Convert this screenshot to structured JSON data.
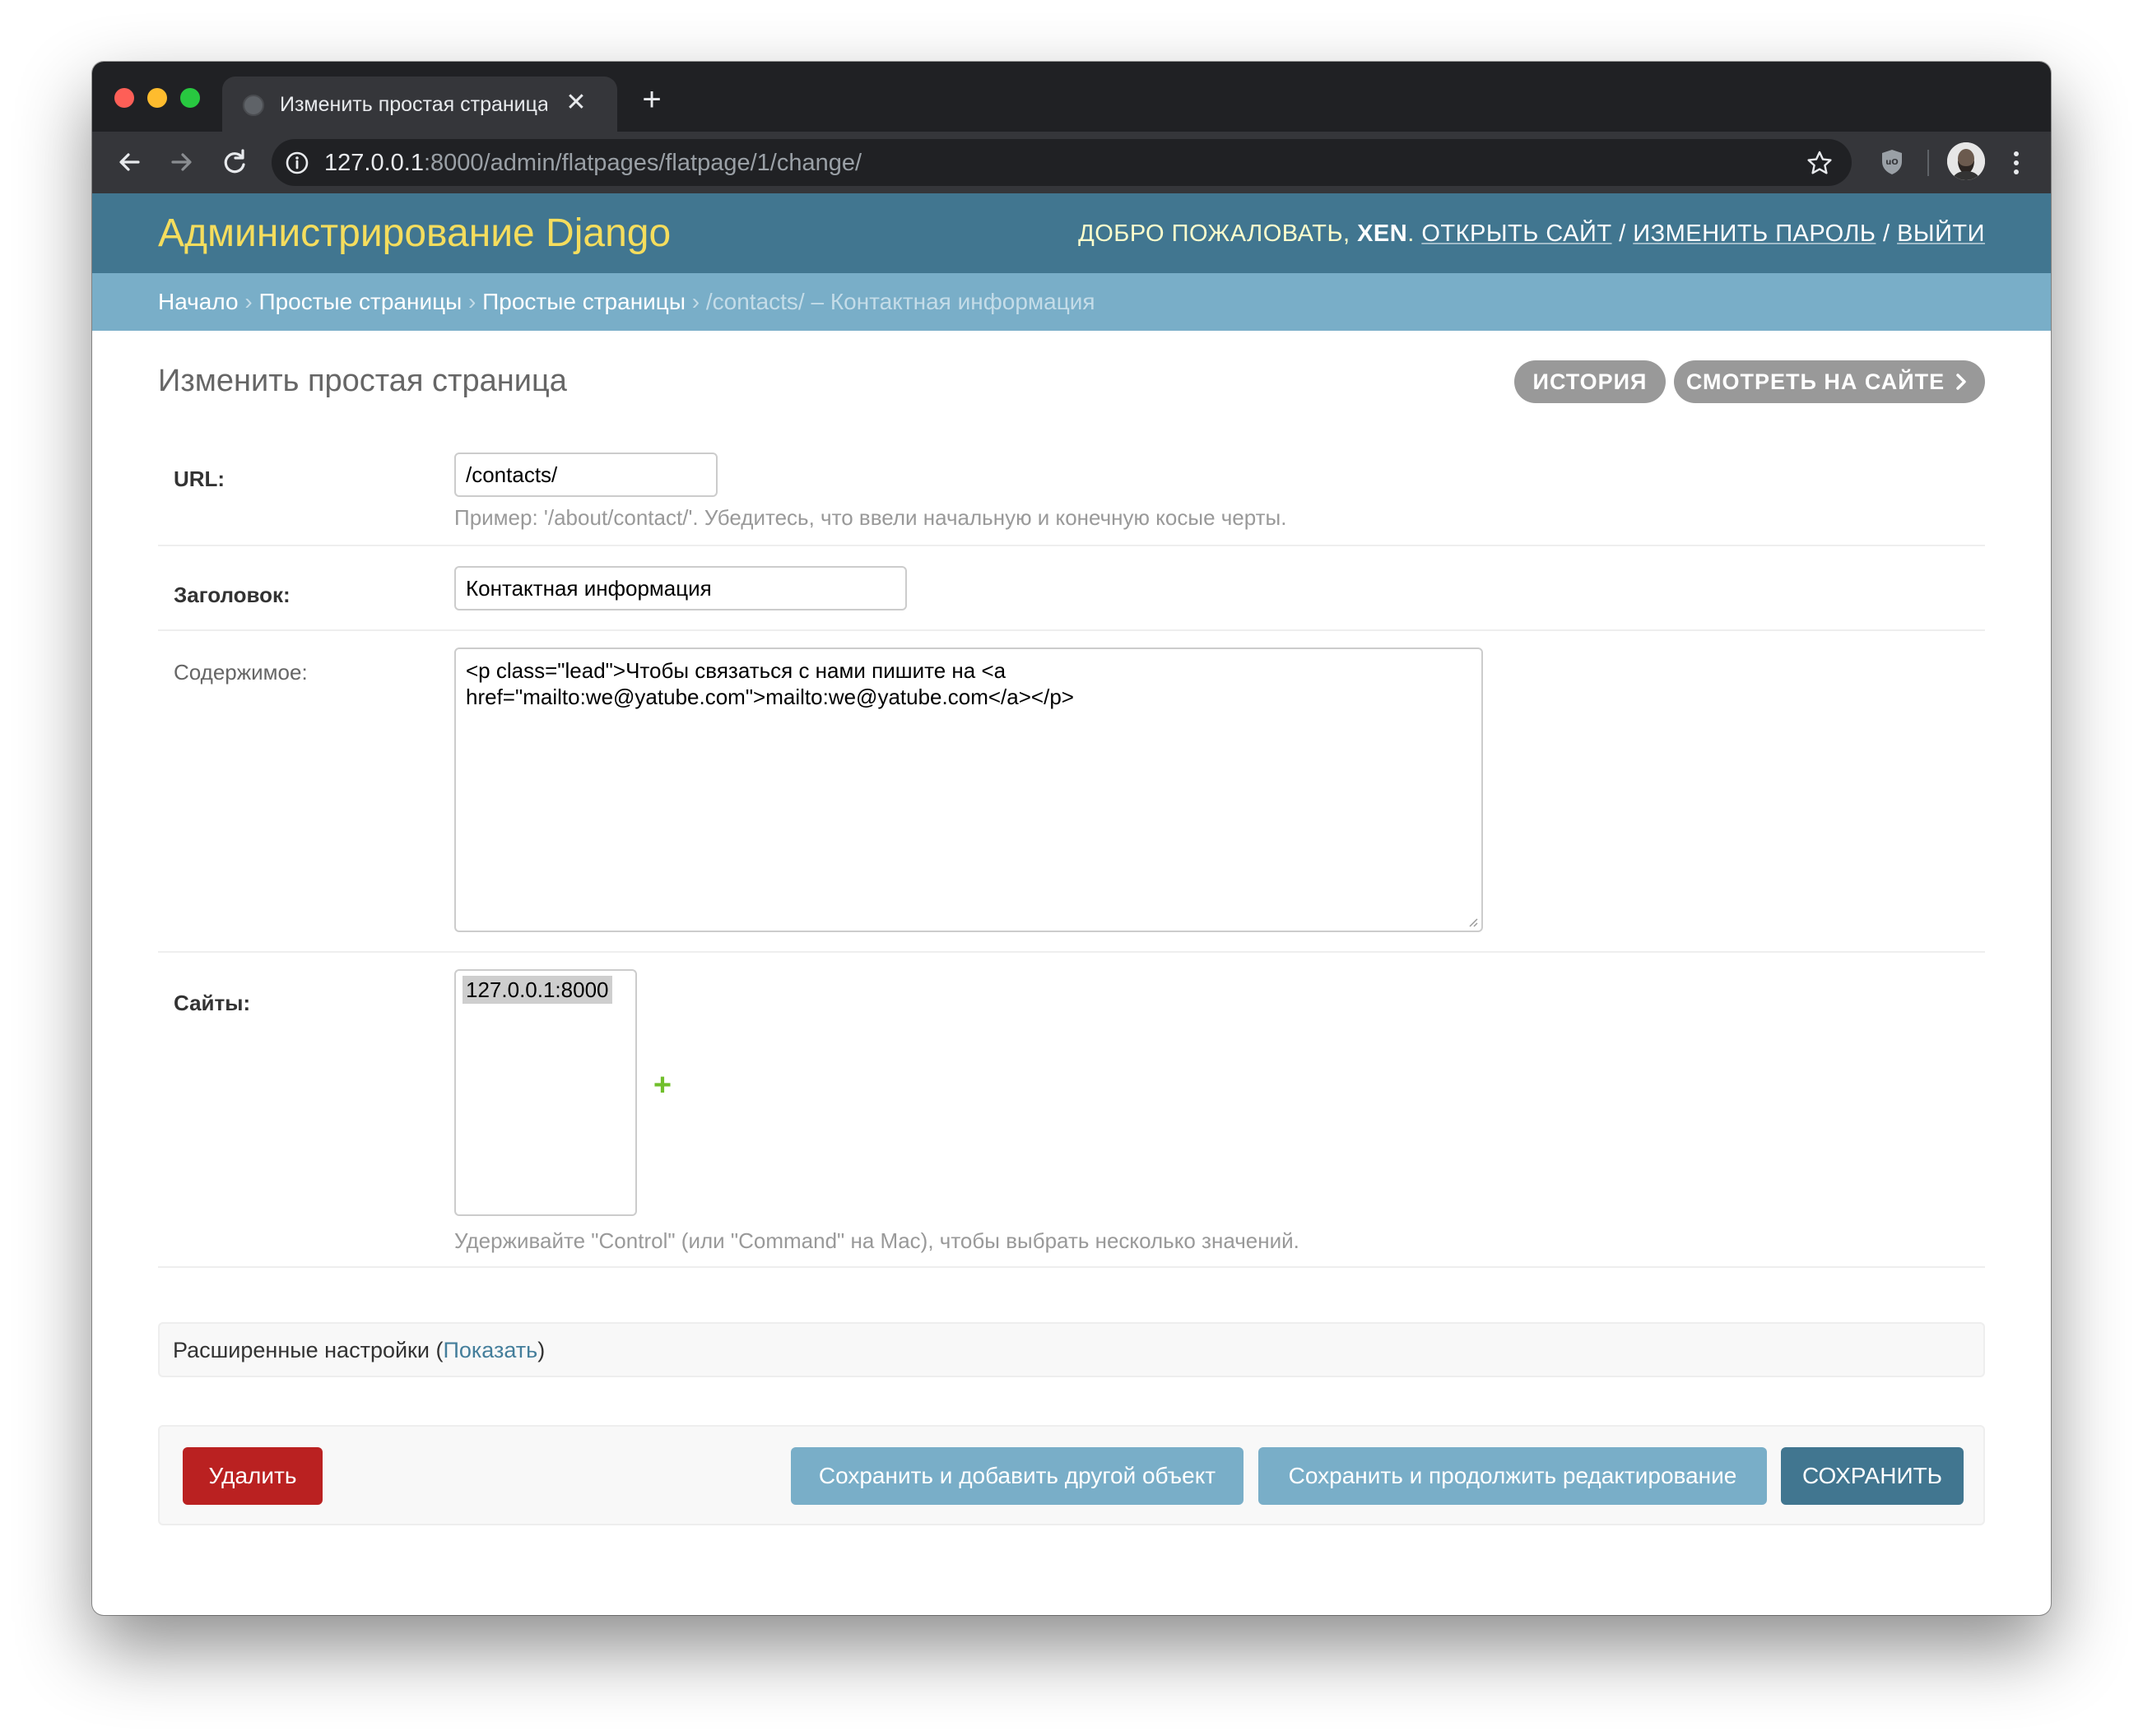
{
  "browser": {
    "tab_title": "Изменить простая страница | Администрирование Django",
    "tab_close": "✕",
    "new_tab": "+",
    "url_host": "127.0.0.1",
    "url_rest": ":8000/admin/flatpages/flatpage/1/change/"
  },
  "header": {
    "brand": "Администрирование Django",
    "welcome": "ДОБРО ПОЖАЛОВАТЬ,",
    "username": "XEN",
    "username_suffix": ".",
    "view_site": "ОТКРЫТЬ САЙТ",
    "separator": "/",
    "change_password": "ИЗМЕНИТЬ ПАРОЛЬ",
    "logout": "ВЫЙТИ"
  },
  "breadcrumbs": {
    "home": "Начало",
    "app": "Простые страницы",
    "model": "Простые страницы",
    "current": "/contacts/ – Контактная информация",
    "sep": "›"
  },
  "page": {
    "title": "Изменить простая страница",
    "history_label": "ИСТОРИЯ",
    "view_on_site_label": "СМОТРЕТЬ НА САЙТЕ"
  },
  "form": {
    "url": {
      "label": "URL:",
      "value": "/contacts/",
      "help": "Пример: '/about/contact/'. Убедитесь, что ввели начальную и конечную косые черты."
    },
    "title": {
      "label": "Заголовок:",
      "value": "Контактная информация"
    },
    "content": {
      "label": "Содержимое:",
      "value": "<p class=\"lead\">Чтобы связаться с нами пишите на <a href=\"mailto:we@yatube.com\">mailto:we@yatube.com</a></p>"
    },
    "sites": {
      "label": "Сайты:",
      "options": [
        "127.0.0.1:8000"
      ],
      "add": "+",
      "help": "Удерживайте \"Control\" (или \"Command\" на Mac), чтобы выбрать несколько значений."
    }
  },
  "advanced": {
    "label": "Расширенные настройки (",
    "toggle": "Показать",
    "close": ")"
  },
  "submit": {
    "delete": "Удалить",
    "save_add_another": "Сохранить и добавить другой объект",
    "save_continue": "Сохранить и продолжить редактирование",
    "save": "СОХРАНИТЬ"
  },
  "colors": {
    "header_bg": "#417690",
    "breadcrumb_bg": "#79aec8",
    "brand_text": "#f5dd5d",
    "delete_bg": "#ba2121",
    "secondary_button_bg": "#79aec8",
    "default_button_bg": "#417690"
  }
}
